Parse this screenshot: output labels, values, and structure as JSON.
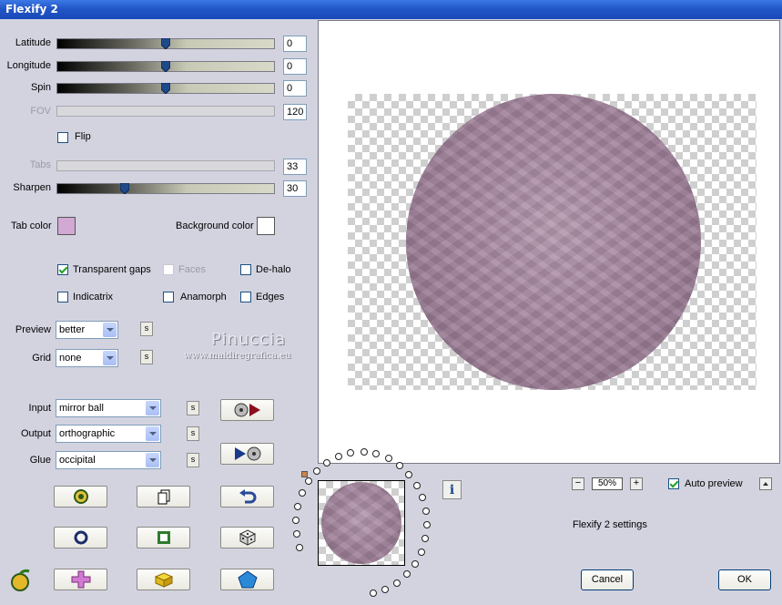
{
  "window": {
    "title": "Flexify 2"
  },
  "sliders": {
    "latitude": {
      "label": "Latitude",
      "value": "0"
    },
    "longitude": {
      "label": "Longitude",
      "value": "0"
    },
    "spin": {
      "label": "Spin",
      "value": "0"
    },
    "fov": {
      "label": "FOV",
      "value": "120"
    },
    "tabs": {
      "label": "Tabs",
      "value": "33"
    },
    "sharpen": {
      "label": "Sharpen",
      "value": "30"
    }
  },
  "flip": {
    "label": "Flip",
    "checked": false
  },
  "colors": {
    "tab_color_label": "Tab color",
    "tab_color": "#d2a9d2",
    "background_color_label": "Background color",
    "background_color": "#ffffff"
  },
  "options": {
    "transparent_gaps": {
      "label": "Transparent gaps",
      "checked": true
    },
    "faces": {
      "label": "Faces",
      "checked": false
    },
    "de_halo": {
      "label": "De-halo",
      "checked": false
    },
    "indicatrix": {
      "label": "Indicatrix",
      "checked": false
    },
    "anamorph": {
      "label": "Anamorph",
      "checked": false
    },
    "edges": {
      "label": "Edges",
      "checked": false
    }
  },
  "preview_quality": {
    "label": "Preview",
    "value": "better"
  },
  "grid": {
    "label": "Grid",
    "value": "none"
  },
  "projection": {
    "input": {
      "label": "Input",
      "value": "mirror ball"
    },
    "output": {
      "label": "Output",
      "value": "orthographic"
    },
    "glue": {
      "label": "Glue",
      "value": "occipital"
    }
  },
  "s_button_label": "s",
  "watermark": {
    "name": "Pinuccia",
    "site": "www.maidiregrafica.eu"
  },
  "zoom": {
    "value": "50%",
    "minus": "−",
    "plus": "+"
  },
  "auto_preview": {
    "label": "Auto preview",
    "checked": true
  },
  "info_label": "i",
  "status_text": "Flexify 2 settings",
  "buttons": {
    "cancel": "Cancel",
    "ok": "OK"
  },
  "icons": {
    "play_input": "play-input-icon",
    "play_output": "play-output-icon",
    "randomize": "randomize-icon",
    "new": "new-page-icon",
    "undo": "undo-icon",
    "circle": "circle-icon",
    "square": "square-icon",
    "dice": "dice-icon",
    "cross": "cross-icon",
    "cube": "cube-icon",
    "pentagon": "pentagon-icon",
    "logo": "flexify-logo-icon"
  },
  "accent": {
    "titlebar": "#2256c8",
    "sphere": "#a88aa2"
  }
}
